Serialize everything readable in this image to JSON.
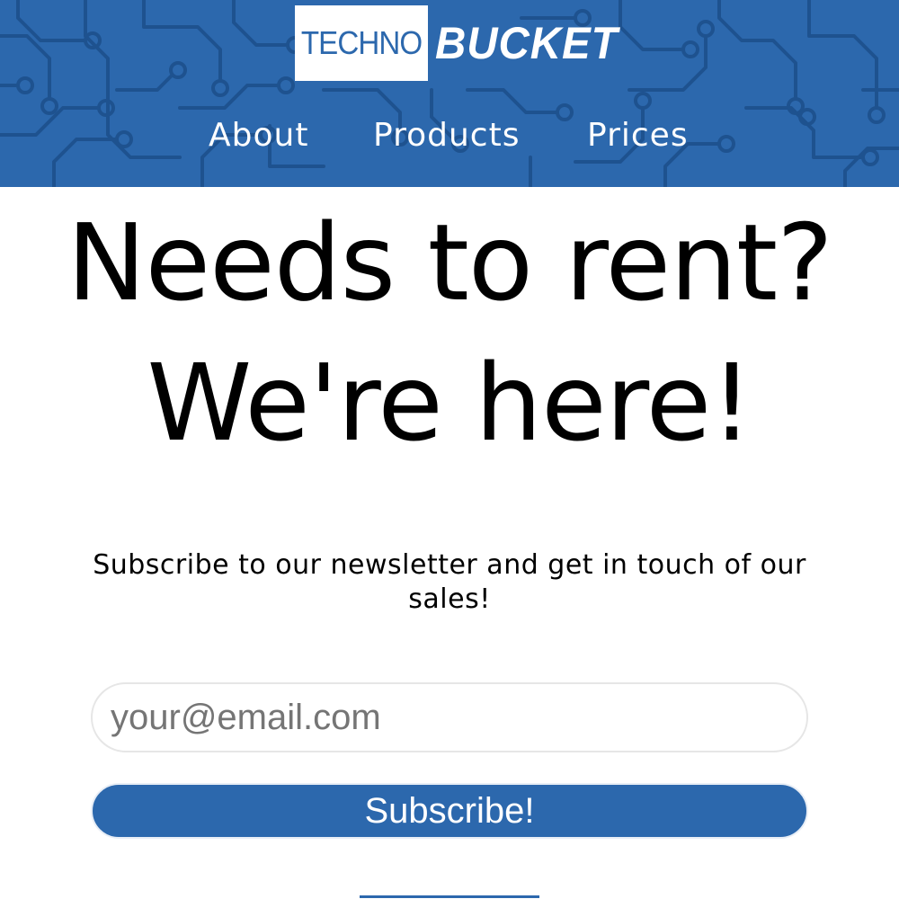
{
  "logo": {
    "left_text": "TECHNO",
    "right_text": "BUCKET"
  },
  "nav": {
    "items": [
      {
        "label": "About"
      },
      {
        "label": "Products"
      },
      {
        "label": "Prices"
      }
    ]
  },
  "hero": {
    "line1": "Needs to rent?",
    "line2": "We're here!"
  },
  "newsletter": {
    "text": "Subscribe to our newsletter and get in touch of our sales!",
    "email_placeholder": "your@email.com",
    "button_label": "Subscribe!"
  },
  "colors": {
    "brand_blue": "#2c68ad",
    "text": "#000000",
    "background": "#ffffff"
  }
}
